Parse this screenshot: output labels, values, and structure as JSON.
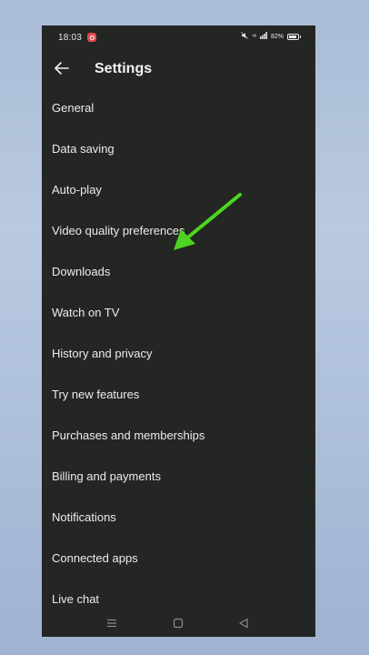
{
  "status_bar": {
    "time": "18:03",
    "signal": "⁴⁶",
    "battery": "82%"
  },
  "header": {
    "title": "Settings"
  },
  "settings_items": [
    {
      "label": "General"
    },
    {
      "label": "Data saving"
    },
    {
      "label": "Auto-play"
    },
    {
      "label": "Video quality preferences"
    },
    {
      "label": "Downloads"
    },
    {
      "label": "Watch on TV"
    },
    {
      "label": "History and privacy"
    },
    {
      "label": "Try new features"
    },
    {
      "label": "Purchases and memberships"
    },
    {
      "label": "Billing and payments"
    },
    {
      "label": "Notifications"
    },
    {
      "label": "Connected apps"
    },
    {
      "label": "Live chat"
    }
  ],
  "icons": {
    "back": "arrow-left-icon",
    "menu": "menu-icon",
    "home": "square-icon",
    "recent_back": "triangle-back-icon"
  },
  "colors": {
    "background": "#232623",
    "text": "#ececec",
    "annotation_arrow": "#4cd41f"
  }
}
